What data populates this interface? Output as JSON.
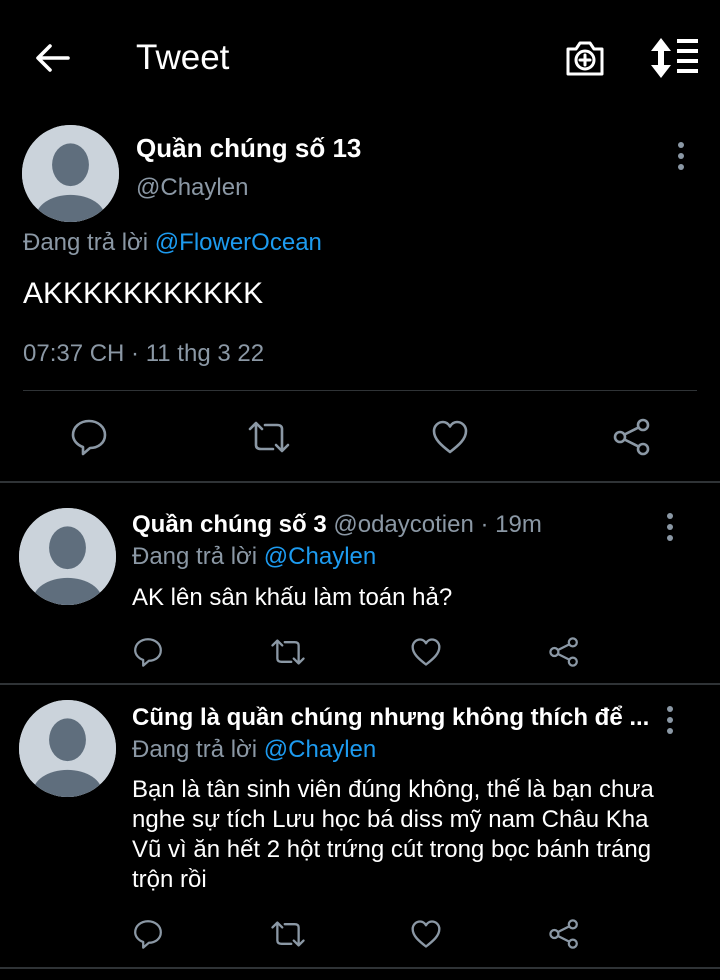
{
  "topbar": {
    "title": "Tweet",
    "back_icon": "arrow-left-icon",
    "camera_icon": "camera-plus-icon",
    "sort_icon": "sort-list-icon"
  },
  "main_tweet": {
    "name": "Quần chúng số 13",
    "handle": "@Chaylen",
    "replying_prefix": "Đang trả lời",
    "replying_to": "@FlowerOcean",
    "text": "AKKKKKKKKKKK",
    "timestamp": "07:37 CH · 11 thg 3 22"
  },
  "replies": [
    {
      "name": "Quần chúng số 3",
      "meta": "@odaycotien · 19m",
      "replying_prefix": "Đang trả lời",
      "replying_to": "@Chaylen",
      "text": "AK lên sân khấu làm toán hả?"
    },
    {
      "name": "Cũng là quần chúng nhưng không thích để ...",
      "meta": "",
      "replying_prefix": "Đang trả lời",
      "replying_to": "@Chaylen",
      "text": "Bạn là tân sinh viên đúng không, thế là bạn chưa nghe sự tích Lưu học bá diss mỹ nam Châu Kha Vũ vì ăn hết 2 hột trứng cút trong bọc bánh tráng trộn rồi"
    }
  ],
  "colors": {
    "background": "#000000",
    "text": "#e7e9ea",
    "secondary": "#8b98a5",
    "accent": "#1d9bf0",
    "divider": "#2f3336"
  }
}
